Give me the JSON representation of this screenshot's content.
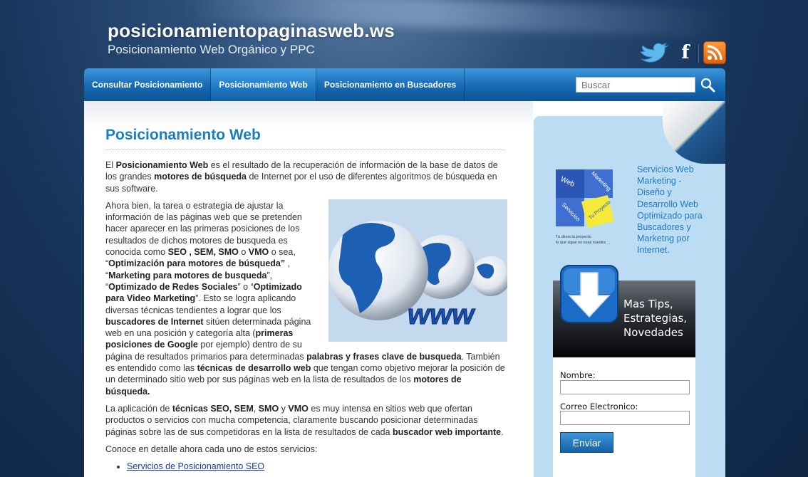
{
  "header": {
    "site_title": "posicionamientopaginasweb.ws",
    "tagline": "Posicionamiento Web Orgánico y PPC",
    "social": {
      "twitter_icon": "twitter-bird-icon",
      "facebook_icon": "facebook-icon",
      "facebook_glyph": "f",
      "rss_icon": "rss-feed-icon"
    }
  },
  "nav": {
    "items": [
      {
        "label": "Consultar Posicionamiento",
        "active": false
      },
      {
        "label": "Posicionamiento Web",
        "active": true
      },
      {
        "label": "Posicionamiento en Buscadores",
        "active": false
      }
    ],
    "search": {
      "placeholder": "Buscar",
      "icon": "magnifier-icon"
    }
  },
  "main": {
    "title": "Posicionamiento Web",
    "image": {
      "text": "www"
    },
    "para1": {
      "t1": "El ",
      "b1": "Posicionamiento Web",
      "t2": " es el resultado de la recuperación de información de la base de datos de los grandes ",
      "b2": "motores de búsqueda",
      "t3": " de Internet por el uso de diferentes algoritmos de búsqueda en sus software."
    },
    "para2": {
      "t1": "Ahora bien, la tarea o estrategia de ajustar la información de las páginas web que se pretenden hacer aparecer en las primeras posiciones de los resultados de dichos motores de busqueda es conocida como ",
      "b1": "SEO , SEM, SMO",
      "t2": " o ",
      "b2": "VMO",
      "t3": " o sea, “",
      "b3": "Optimización para motores de búsqueda”",
      "t4": " , “",
      "b4": "Marketing para motores de busqueda",
      "t5": "”, “",
      "b5": "Optimizado de Redes Sociales",
      "t6": "” o “",
      "b6": "Optimizado para Video Marketing",
      "t7": "”. Esto se logra aplicando diversas técnicas tendientes a lograr que los ",
      "b7": "buscadores de Internet",
      "t8": " sitúen determinada página web en una posición y categoría alta (",
      "b8": "primeras posiciones de Google",
      "t9": " por ejemplo) dentro de su página de resultados primarios para determinadas ",
      "b9": "palabras y frases clave de busqueda",
      "t10": ". También es entendido como las ",
      "b10": "técnicas de desarrollo web",
      "t11": " que tengan como objetivo mejorar la posición de un determinado sitio web por sus páginas web en la lista de resultados de los ",
      "b11": "motores de búsqueda."
    },
    "para3": {
      "t1": "La aplicación de ",
      "b1": "técnicas SEO, SEM",
      "t2": ", ",
      "b2": "SMO",
      "t3": " y ",
      "b3": "VMO",
      "t4": " es muy intensa en sitios web que ofertan productos o servicios con mucha competencia, claramente buscando posicionar determinadas páginas sobre las de sus competidoras en la lista de resultados de cada ",
      "b4": "buscador web importante",
      "t5": "."
    },
    "para4": "Conoce en detalle ahora cada uno de estos servicios:",
    "links": [
      "Servicios de Posicionamiento SEO"
    ]
  },
  "sidebar": {
    "promo_link": "Servicios Web Marketing - Diseño y Desarrollo Web Optimizado para Buscadores y Marketng por Internet.",
    "puzzle": {
      "pieces": [
        "Web",
        "Marketing",
        "Servicios",
        "Tu Proyecto"
      ],
      "caption_1": "Tu dinos tu proyecto",
      "caption_2": "lo que sigue es cosa nuestra ..."
    },
    "tips_box": {
      "text": "Mas Tips, Estrategias, Novedades",
      "icon": "download-arrow-icon"
    },
    "form": {
      "name_label": "Nombre:",
      "name_value": "",
      "email_label": "Correo Electronico:",
      "email_value": "",
      "submit_label": "Enviar"
    }
  },
  "colors": {
    "accent": "#1a7fc0",
    "nav": "#1669b3",
    "sidebar": "#bcdcf3",
    "link": "#1a3d91"
  }
}
